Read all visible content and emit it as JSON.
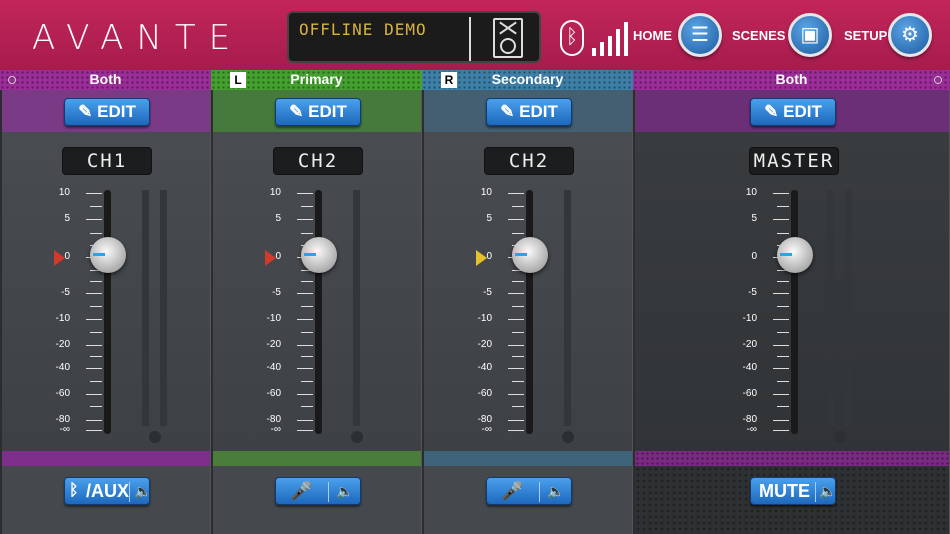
{
  "app": {
    "brand": "AVANTE"
  },
  "display": {
    "status_text": "OFFLINE DEMO"
  },
  "nav": {
    "home_label": "HOME",
    "scenes_label": "SCENES",
    "setup_label": "SETUP"
  },
  "zones": [
    {
      "label": "Both",
      "color": "#9b2d99"
    },
    {
      "label": "Primary",
      "tag": "L",
      "color": "#44a12f"
    },
    {
      "label": "Secondary",
      "tag": "R",
      "color": "#3e7fa8"
    },
    {
      "label": "Both",
      "color": "#9b2d99"
    }
  ],
  "scale_labels": [
    "10",
    "5",
    "0",
    "-5",
    "-10",
    "-20",
    "-40",
    "-60",
    "-80",
    "-∞"
  ],
  "strips": [
    {
      "edit_label": "EDIT",
      "channel": "CH1",
      "bottom_label": "/AUX",
      "bottom_icon": "bluetooth-icon",
      "arrow_color": "#d23a2b",
      "header_color": "#7a3a86",
      "foot_color": "#7e2f8a"
    },
    {
      "edit_label": "EDIT",
      "channel": "CH2",
      "bottom_label": "",
      "bottom_icon": "microphone-icon",
      "arrow_color": "#d23a2b",
      "header_color": "#467a3c",
      "foot_color": "#4a7d3c"
    },
    {
      "edit_label": "EDIT",
      "channel": "CH2",
      "bottom_label": "",
      "bottom_icon": "microphone-icon",
      "arrow_color": "#e5c22a",
      "header_color": "#445f72",
      "foot_color": "#3f6379"
    },
    {
      "edit_label": "EDIT",
      "channel": "MASTER",
      "bottom_label": "MUTE",
      "bottom_icon": "speaker-icon",
      "arrow_color": "",
      "header_color": "#6b2f78",
      "foot_color": "#7a2a83"
    }
  ]
}
